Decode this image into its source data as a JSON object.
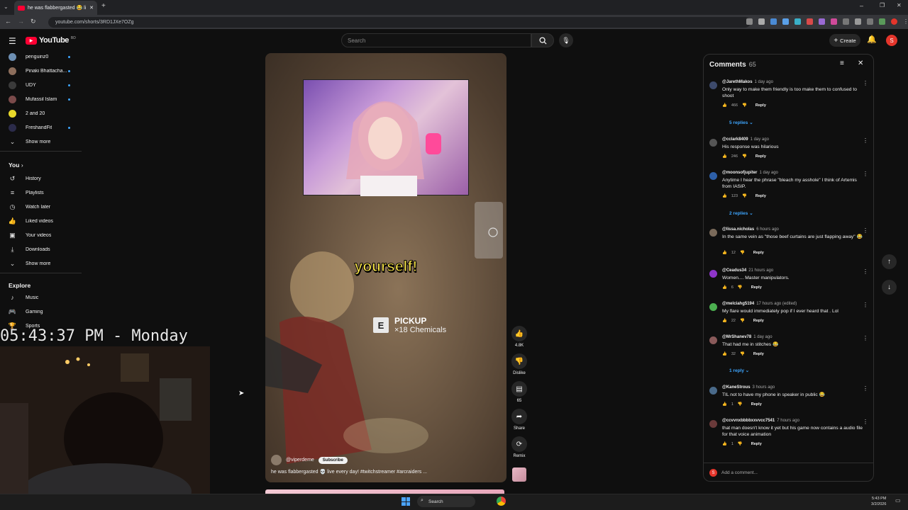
{
  "browser": {
    "tab_title": "he was flabbergasted 😂 li",
    "url": "youtube.com/shorts/3RD1JXe7OZg"
  },
  "header": {
    "logo_text": "YouTube",
    "logo_sup": "BD",
    "search_placeholder": "Search",
    "create_label": "Create",
    "avatar_letter": "S"
  },
  "sidebar": {
    "subscriptions": [
      {
        "label": "penguinz0",
        "color": "#6d8fb3"
      },
      {
        "label": "Pinaki Bhattacha...",
        "color": "#8d6e5c"
      },
      {
        "label": "UDY",
        "color": "#3a3a3a"
      },
      {
        "label": "Mufassil Islam",
        "color": "#7a4a4a"
      },
      {
        "label": "2 and 20",
        "color": "#e8d82a"
      },
      {
        "label": "FreshandFit",
        "color": "#2b2b4a"
      }
    ],
    "show_more_1": "Show more",
    "you_heading": "You",
    "you_items": [
      "History",
      "Playlists",
      "Watch later",
      "Liked videos",
      "Your videos",
      "Downloads"
    ],
    "show_more_2": "Show more",
    "explore_heading": "Explore",
    "explore_items": [
      "Music",
      "Gaming",
      "Sports"
    ]
  },
  "overlay": {
    "clock": "05:43:37 PM - Monday"
  },
  "video": {
    "caption": "yourself!",
    "pickup_key": "E",
    "pickup_title": "PICKUP",
    "pickup_item": "×18 Chemicals",
    "channel": "@viperdeme",
    "subscribe": "Subscribe",
    "title": "he was flabbergasted 💀 live every day! #twitchstreamer #arcraiders ..."
  },
  "actions": {
    "likes": "4.8K",
    "dislike": "Dislike",
    "comments": "65",
    "share": "Share",
    "remix": "Remix"
  },
  "comments": {
    "title": "Comments",
    "count": "65",
    "add_placeholder": "Add a comment...",
    "items": [
      {
        "user": "@JarethMakos",
        "time": "1 day ago",
        "text": "Only way to make them friendly is too make them to confused to shoot",
        "likes": "466",
        "avatar_color": "#3d4a6b",
        "replies": "5 replies"
      },
      {
        "user": "@cclark8409",
        "time": "1 day ago",
        "text": "His response was hilarious",
        "likes": "246",
        "avatar_color": "#555555",
        "replies": ""
      },
      {
        "user": "@moonsofjupiter",
        "time": "1 day ago",
        "text": "Anytime I hear the phrase \"bleach my asshole\" I think of Artemis from IASIP.",
        "likes": "123",
        "avatar_color": "#2d5fa8",
        "replies": "2 replies"
      },
      {
        "user": "@lissa.nicholas",
        "time": "6 hours ago",
        "text": "In the same vein as \"those beef curtains are just flapping away\" 😂",
        "likes": "12",
        "avatar_color": "#7a6a5a",
        "replies": ""
      },
      {
        "user": "@Ceadus34",
        "time": "21 hours ago",
        "text": "Women.... Master manipulators.",
        "likes": "6",
        "avatar_color": "#8e35c9",
        "replies": ""
      },
      {
        "user": "@melciahg5194",
        "time": "17 hours ago (edited)",
        "text": "My flare would immediately pop if I ever heard that . Lol",
        "likes": "22",
        "avatar_color": "#4caf50",
        "replies": ""
      },
      {
        "user": "@MrShanev78",
        "time": "1 day ago",
        "text": "That had me in stitches 😂",
        "likes": "32",
        "avatar_color": "#8a5a5a",
        "replies": "1 reply"
      },
      {
        "user": "@KaneStrous",
        "time": "3 hours ago",
        "text": "TIL  not to have my phone in speaker in public 😂",
        "likes": "1",
        "avatar_color": "#4a6a8a",
        "replies": ""
      },
      {
        "user": "@ccvvnxbbbbxxvvcc7541",
        "time": "7 hours ago",
        "text": "that man doesn't know it yet but his game now contains a audio file for that voice animation",
        "likes": "1",
        "avatar_color": "#6a3a3a",
        "replies": ""
      }
    ]
  },
  "taskbar": {
    "search": "Search",
    "time": "5:43 PM",
    "date": "3/2/2026"
  }
}
